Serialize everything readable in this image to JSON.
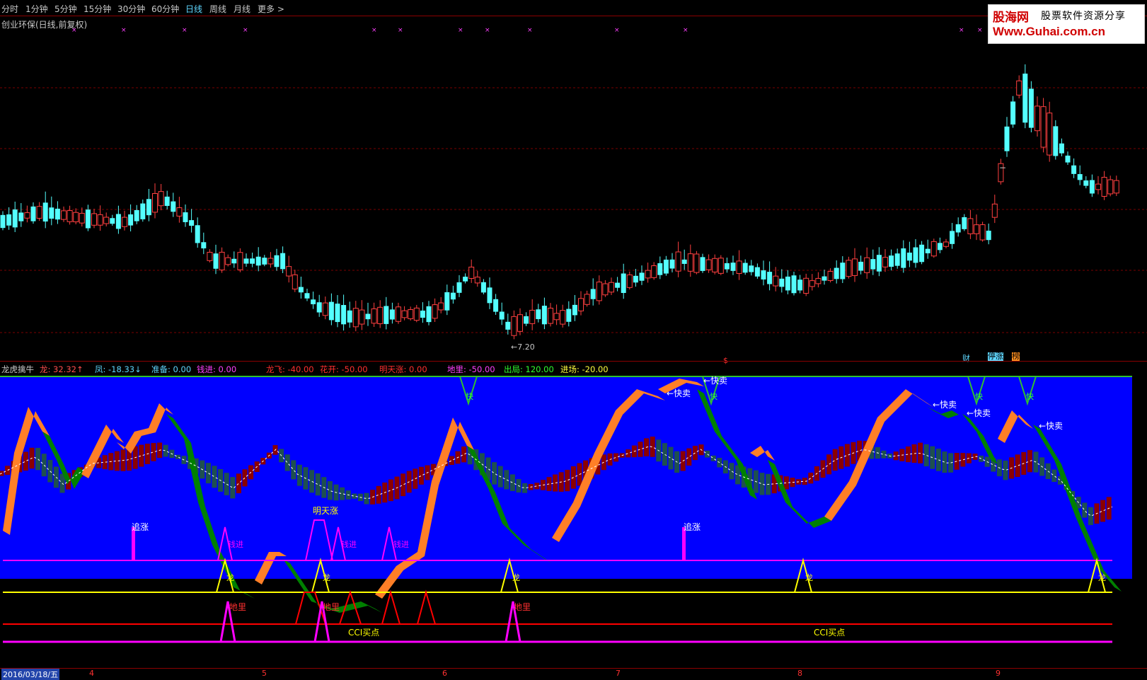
{
  "toolbar": {
    "items": [
      "分时",
      "1分钟",
      "5分钟",
      "15分钟",
      "30分钟",
      "60分钟",
      "日线",
      "周线",
      "月线",
      "更多 >"
    ],
    "active": "日线"
  },
  "stock_title": "创业环保(日线,前复权)",
  "logo": {
    "line1_a": "股海网",
    "line1_b": "股票软件资源分享",
    "line2": "Www.Guhai.com.cn"
  },
  "price_chart": {
    "low_label": "←7.20",
    "dash_label": "−",
    "bottom_markers": {
      "dollar": "$",
      "cai": "财",
      "tingzhang": "停涨",
      "bang": "榜"
    }
  },
  "indicator_header": {
    "name": "龙虎擒牛",
    "long": "龙: 32.32↑",
    "feng": "凤: -18.33↓",
    "zhunbei": "准备: 0.00",
    "qianjin": "钱进: 0.00",
    "longfei": "龙飞: -40.00",
    "huakai": "花开: -50.00",
    "mingtianzhang": "明天涨: 0.00",
    "dili": "地里: -50.00",
    "chuju": "出局: 120.00",
    "jinchang": "进场: -20.00"
  },
  "indicator_labels": {
    "kuaimai": "←快卖",
    "zhuizhang": "追涨",
    "mingtianzhang": "明天涨",
    "qianjin": "钱进",
    "long": "龙",
    "dili": "地里",
    "cci": "CCI买点",
    "kuai": "快"
  },
  "datebar": {
    "date": "2016/03/18/五",
    "months": [
      "4",
      "5",
      "6",
      "7",
      "8",
      "9"
    ]
  },
  "colors": {
    "up": "#ff4040",
    "down": "#54ffff",
    "panel_bg": "#0000ff",
    "orange": "#ff7f27",
    "green": "#008000",
    "magenta": "#ff00ff",
    "yellow": "#ffff00",
    "red": "#ff0000"
  }
}
